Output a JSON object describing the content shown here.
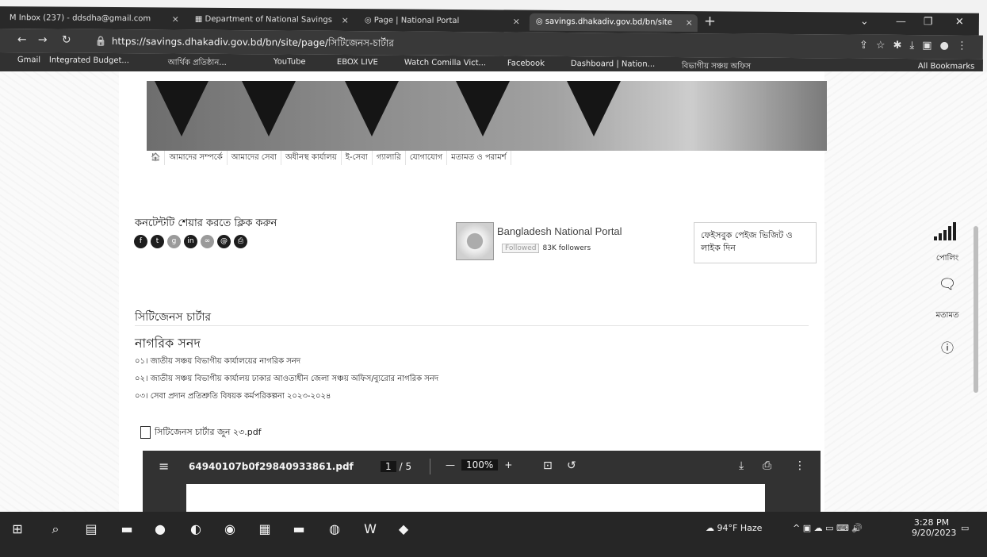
{
  "browser": {
    "tabs": [
      {
        "label": "Inbox (237) - ddsdha@gmail.com",
        "active": false
      },
      {
        "label": "Department of National Savings",
        "active": false
      },
      {
        "label": "Page | National Portal",
        "active": false
      },
      {
        "label": "savings.dhakadiv.gov.bd/bn/site",
        "active": true
      }
    ],
    "url": "https://savings.dhakadiv.gov.bd/bn/site/page/সিটিজেনস-চার্টার",
    "bookmarks": [
      "Gmail",
      "Integrated Budget...",
      "আর্থিক প্রতিষ্ঠান...",
      "YouTube",
      "EBOX LIVE",
      "Watch Comilla Vict...",
      "Facebook",
      "Dashboard | Nation...",
      "বিভাগীয় সঞ্চয় অফিস"
    ],
    "all_bookmarks": "All Bookmarks"
  },
  "site": {
    "menu": [
      "আমাদের সম্পর্কে",
      "আমাদের সেবা",
      "অধীনস্থ কার্যালয়",
      "ই-সেবা",
      "গ্যালারি",
      "যোগাযোগ",
      "মতামত ও পরামর্শ"
    ],
    "share_label": "কনটেন্টটি শেয়ার করতে ক্লিক করুন",
    "fb": {
      "name": "Bangladesh National Portal",
      "follow_btn": "Followed",
      "followers": "83K followers",
      "card": "ফেইসবুক পেইজ ভিজিট ও লাইক দিন"
    },
    "section_title": "সিটিজেনস চার্টার",
    "charter_heading": "নাগরিক সনদ",
    "charter_items": [
      "০১। জাতীয় সঞ্চয় বিভাগীয় কার্যালয়ের নাগরিক সনদ",
      "০২। জাতীয় সঞ্চয় বিভাগীয় কার্যালয় ঢাকার আওতাধীন জেলা সঞ্চয় অফিস/ব্যুরোর নাগরিক সনদ",
      "০৩। সেবা প্রদান প্রতিশ্রুতি বিষয়ক কর্মপরিকল্পনা ২০২৩-২০২৪"
    ],
    "pdf_link": "সিটিজেনস চার্টার জুন ২৩.pdf"
  },
  "viewer": {
    "filename": "64940107b0f29840933861.pdf",
    "page_current": "1",
    "page_total": "/ 5",
    "zoom": "100%"
  },
  "side": {
    "poll": "পোলিং",
    "feedback": "মতামত"
  },
  "taskbar": {
    "weather": "94°F Haze",
    "time": "3:28 PM",
    "date": "9/20/2023"
  }
}
